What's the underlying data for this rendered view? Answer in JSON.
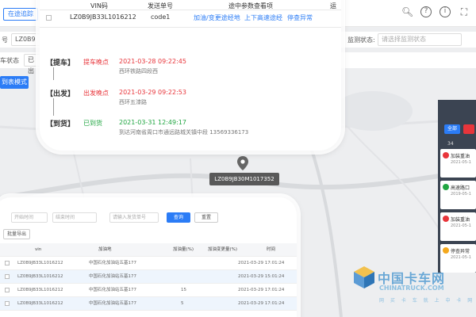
{
  "header": {
    "left_button": "在途追踪",
    "icons": [
      "search-icon",
      "help-icon",
      "info-icon",
      "fullscreen-icon"
    ]
  },
  "filters": {
    "vin_label": "号",
    "vin_value": "LZ0B9",
    "status_label": "车状态",
    "status_value": "已出",
    "monitor_label": "监测状态:",
    "monitor_placeholder": "请选择监测状态",
    "mode_button": "到表模式"
  },
  "top_card": {
    "headers": [
      "VIN码",
      "发送单号",
      "途中参数查看项",
      "运"
    ],
    "vin": "LZ0B9JB33L1016212",
    "code": "code1",
    "links": [
      "加油/变更途经地",
      "上下高速途经",
      "停查异常"
    ],
    "timeline": [
      {
        "tag": "【提车】",
        "status": "提车晚点",
        "time": "2021-03-28 09:22:45",
        "detail": "西环铁路四段西",
        "color": "red"
      },
      {
        "tag": "【出发】",
        "status": "出发晚点",
        "time": "2021-03-29 09:22:53",
        "detail": "西环五漆路",
        "color": "red"
      },
      {
        "tag": "【到货】",
        "status": "已到货",
        "time": "2021-03-31 12:49:17",
        "detail": "到达河南省周口市通远路城关镇中段 13569336173",
        "color": "green"
      }
    ]
  },
  "marker": {
    "label": "LZ0B9JB30M1017352"
  },
  "right_panel": {
    "all_button": "全部",
    "count": "34",
    "items": [
      {
        "title": "加装重油",
        "sub": "2021-05-1",
        "dot": "#e8353b"
      },
      {
        "title": "高速路口",
        "sub": "2019-05-1",
        "dot": "#21a642"
      },
      {
        "title": "加装重油",
        "sub": "2021-05-1",
        "dot": "#e8353b"
      },
      {
        "title": "停查异常",
        "sub": "2021-05-1",
        "dot": "#f4a81d"
      }
    ]
  },
  "bottom_card": {
    "start_placeholder": "开始时间",
    "end_placeholder": "结束时间",
    "route_placeholder": "请输入发货单号",
    "query_button": "查询",
    "reset_button": "重置",
    "export_button": "批量导出",
    "columns": [
      "vin",
      "加油地",
      "加油量(%)",
      "加油变更量(%)",
      "时间"
    ],
    "rows": [
      {
        "vin": "LZ0B9JB33L1016212",
        "place": "中国石化加油站五基177",
        "amount": "",
        "change": "",
        "time": "2021-03-29 17:01:24"
      },
      {
        "vin": "LZ0B9JB33L1016212",
        "place": "中国石化加油站五基177",
        "amount": "",
        "change": "",
        "time": "2021-03-29 15:01:24"
      },
      {
        "vin": "LZ0B9JB33L1016212",
        "place": "中国石化加油站五基177",
        "amount": "15",
        "change": "",
        "time": "2021-03-29 17:01:24"
      },
      {
        "vin": "LZ0B9JB33L1016212",
        "place": "中国石化加油站五基177",
        "amount": "5",
        "change": "",
        "time": "2021-03-29 17:01:24"
      }
    ]
  },
  "watermark": {
    "cn": "中国卡车网",
    "en": "CHINATRUCK.COM",
    "sub": "网 买 卡 车 就 上 中 卡 网"
  }
}
